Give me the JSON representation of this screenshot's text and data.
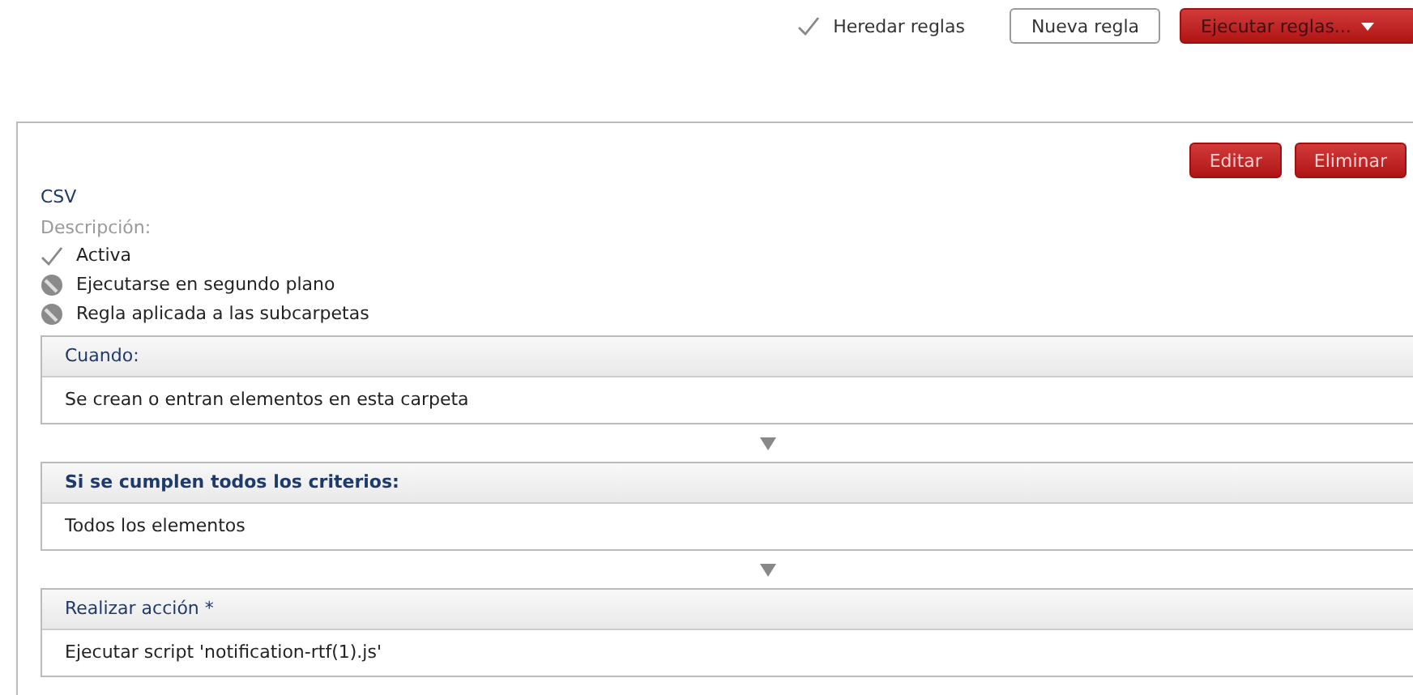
{
  "toolbar": {
    "inherit": {
      "label": "Heredar reglas",
      "checked": true
    },
    "buttons": [
      {
        "label": "Nueva regla",
        "kind": "plain"
      },
      {
        "label": "Ejecutar reglas...",
        "kind": "dropdown"
      }
    ]
  },
  "rule": {
    "actions": [
      "Editar",
      "Eliminar"
    ],
    "name": "CSV",
    "description_label": "Descripción:",
    "flags": [
      {
        "label": "Activa",
        "checked": true
      },
      {
        "label": "Ejecutarse en segundo plano",
        "checked": false
      },
      {
        "label": "Regla aplicada a las subcarpetas",
        "checked": false
      }
    ],
    "sections": [
      {
        "title": "Cuando:",
        "bold": false,
        "value": "Se crean o entran elementos en esta carpeta"
      },
      {
        "title": "Si se cumplen todos los criterios:",
        "bold": true,
        "value": "Todos los elementos"
      },
      {
        "title": "Realizar acción *",
        "bold": false,
        "value": "Ejecutar script 'notification-rtf(1).js'"
      }
    ]
  }
}
